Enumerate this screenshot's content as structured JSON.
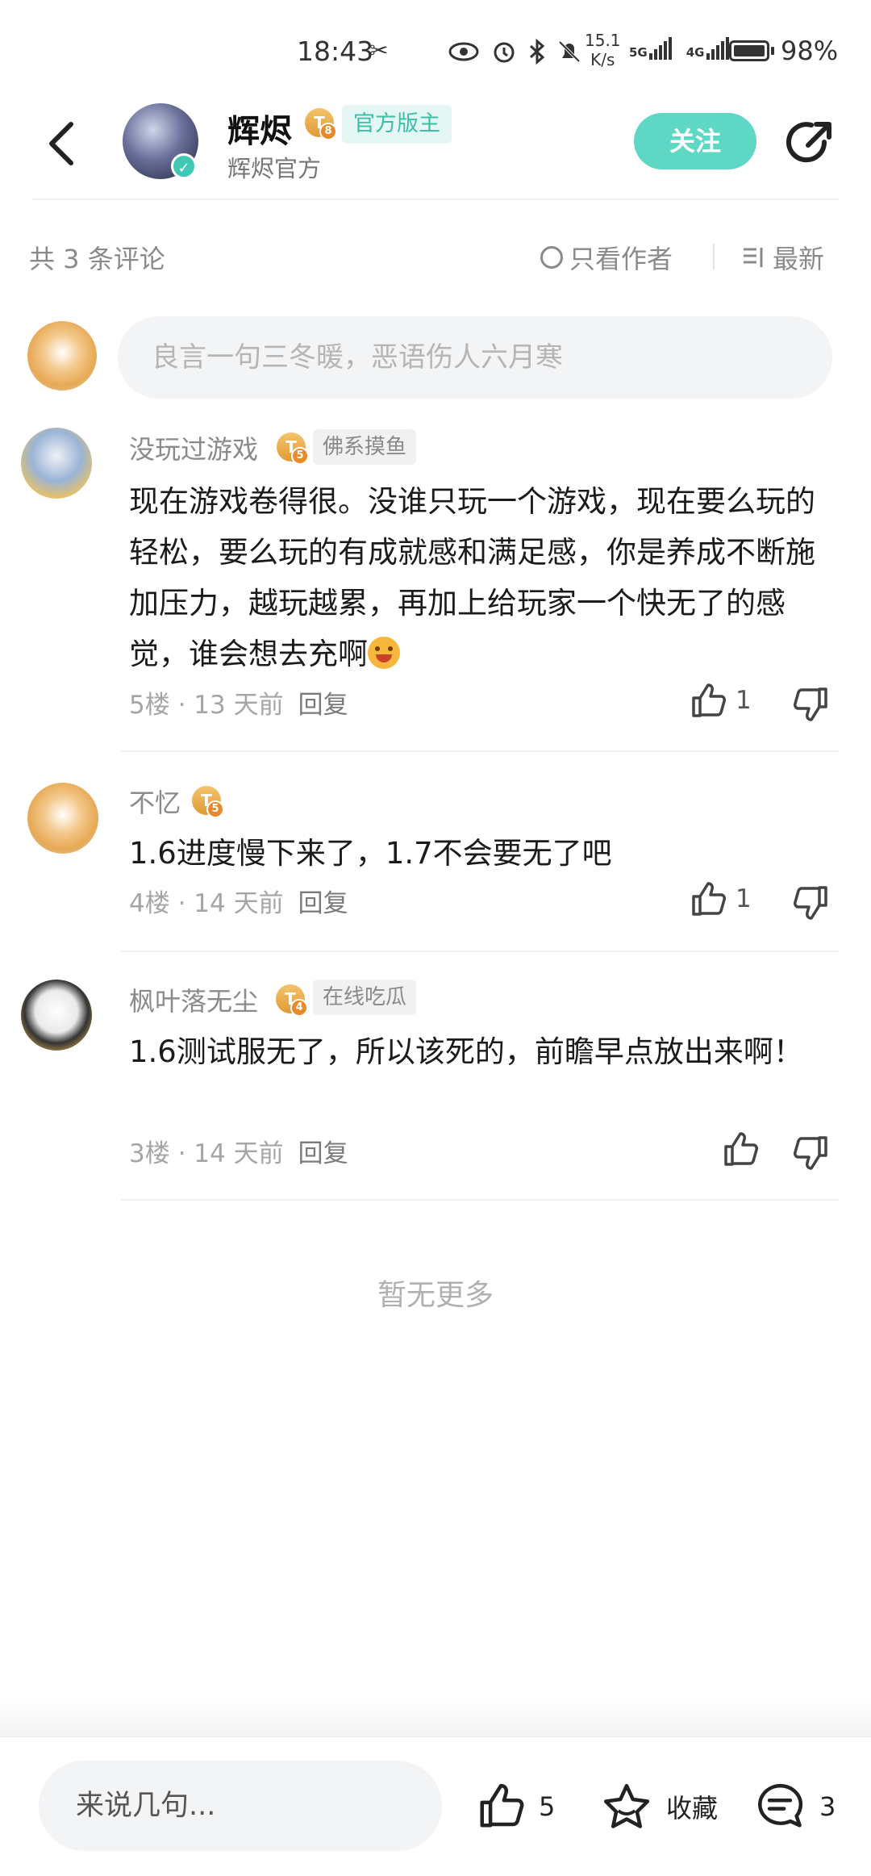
{
  "status_bar": {
    "time": "18:43",
    "speed_value": "15.1",
    "speed_unit": "K/s",
    "net1": "5G",
    "net2": "4G",
    "battery": "98%"
  },
  "header": {
    "name": "辉烬",
    "level": "8",
    "role_badge": "官方版主",
    "subtitle": "辉烬官方",
    "follow_label": "关注"
  },
  "filter": {
    "count_label": "共 3 条评论",
    "only_author_label": "只看作者",
    "sort_label": "最新"
  },
  "comment_input": {
    "placeholder": "良言一句三冬暖，恶语伤人六月寒"
  },
  "comments": [
    {
      "name": "没玩过游戏",
      "level": "5",
      "tag": "佛系摸鱼",
      "text": "现在游戏卷得很。没谁只玩一个游戏，现在要么玩的轻松，要么玩的有成就感和满足感，你是养成不断施加压力，越玩越累，再加上给玩家一个快无了的感觉，谁会想去充啊",
      "meta": "5楼 · 13 天前",
      "reply_label": "回复",
      "likes": "1"
    },
    {
      "name": "不忆",
      "level": "5",
      "tag": "",
      "text": "1.6进度慢下来了，1.7不会要无了吧",
      "meta": "4楼 · 14 天前",
      "reply_label": "回复",
      "likes": "1"
    },
    {
      "name": "枫叶落无尘",
      "level": "4",
      "tag": "在线吃瓜",
      "text": "1.6测试服无了，所以该死的，前瞻早点放出来啊！",
      "meta": "3楼 · 14 天前",
      "reply_label": "回复",
      "likes": ""
    }
  ],
  "no_more": "暂无更多",
  "bottom_bar": {
    "placeholder": "来说几句...",
    "likes": "5",
    "collect_label": "收藏",
    "comments": "3"
  },
  "colors": {
    "accent": "#5ed8c4",
    "badge_text": "#3cbfa9",
    "level_badge": "#e8a23d"
  }
}
